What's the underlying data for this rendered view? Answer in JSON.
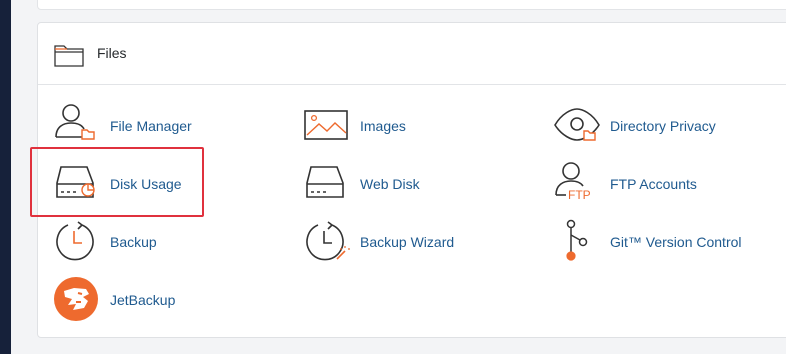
{
  "files_section": {
    "title": "Files",
    "icon": "folder-icon",
    "items": [
      {
        "label": "File Manager",
        "icon": "file-manager-icon"
      },
      {
        "label": "Images",
        "icon": "images-icon"
      },
      {
        "label": "Directory Privacy",
        "icon": "directory-privacy-icon"
      },
      {
        "label": "Disk Usage",
        "icon": "disk-usage-icon",
        "highlighted": true
      },
      {
        "label": "Web Disk",
        "icon": "web-disk-icon"
      },
      {
        "label": "FTP Accounts",
        "icon": "ftp-accounts-icon",
        "icon_text": "FTP"
      },
      {
        "label": "Backup",
        "icon": "backup-icon"
      },
      {
        "label": "Backup Wizard",
        "icon": "backup-wizard-icon"
      },
      {
        "label": "Git™ Version Control",
        "icon": "git-icon"
      },
      {
        "label": "JetBackup",
        "icon": "jetbackup-icon"
      }
    ]
  },
  "colors": {
    "link": "#1f5a8f",
    "accent": "#ee6a2e",
    "highlight_border": "#e0313d",
    "sidebar": "#16213a"
  }
}
